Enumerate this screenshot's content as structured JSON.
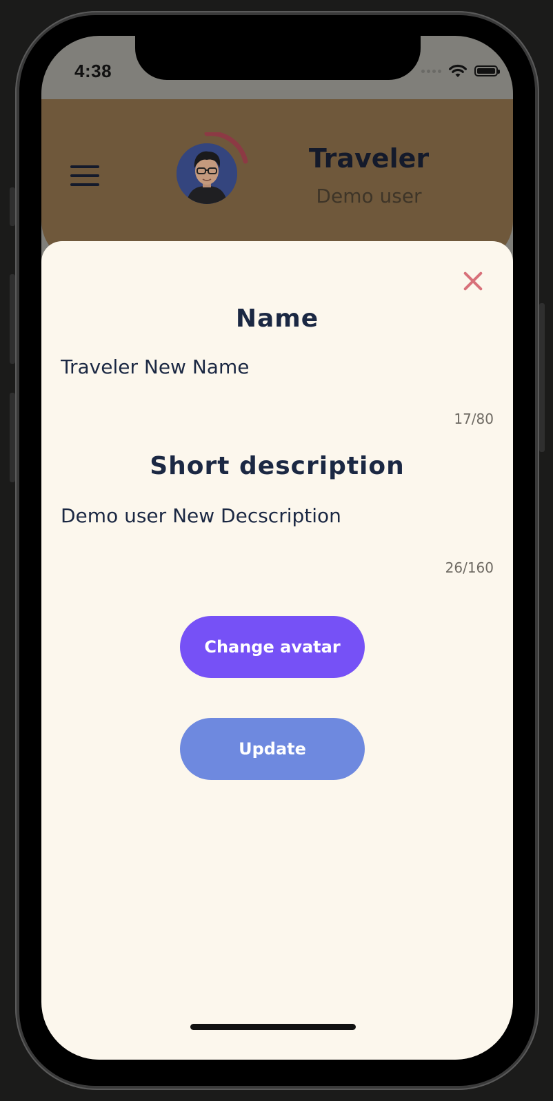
{
  "status_bar": {
    "time": "4:38"
  },
  "header": {
    "title": "Traveler",
    "subtitle": "Demo user"
  },
  "modal": {
    "name_section": {
      "title": "Name",
      "value": "Traveler New Name",
      "counter": "17/80"
    },
    "description_section": {
      "title": "Short description",
      "value": "Demo user New Decscription",
      "counter": "26/160"
    },
    "change_avatar_label": "Change avatar",
    "update_label": "Update"
  },
  "colors": {
    "header_bg": "#6f583b",
    "sheet_bg": "#fcf7ed",
    "close_icon": "#d8717a",
    "change_avatar_btn": "#7651f6",
    "update_btn": "#6e89df",
    "text_dark": "#1b2843",
    "progress_arc": "#8c3a44"
  },
  "icons": [
    "menu-icon",
    "wifi-icon",
    "battery-icon",
    "close-icon",
    "cellular-signal-icon"
  ]
}
